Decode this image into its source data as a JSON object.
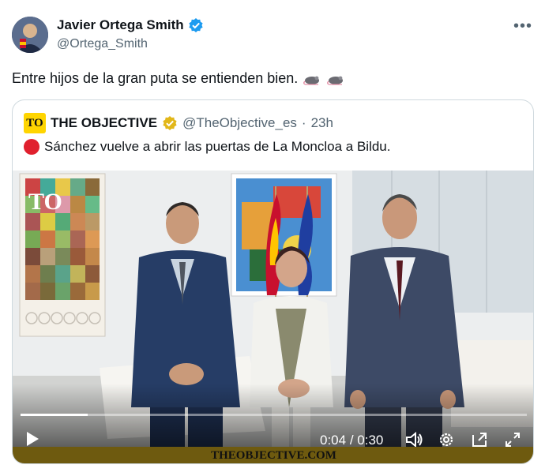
{
  "author": {
    "name": "Javier Ortega Smith",
    "handle": "@Ortega_Smith"
  },
  "tweet": {
    "text": "Entre hijos de la gran puta se entienden bien.",
    "emoji": [
      "rat-icon",
      "rat-icon"
    ]
  },
  "quote": {
    "logo_text": "TO",
    "name": "THE OBJECTIVE",
    "handle": "@TheObjective_es",
    "separator": "·",
    "time": "23h",
    "text": "Sánchez vuelve a abrir las puertas de La Moncloa a Bildu."
  },
  "video": {
    "overlay_logo": "TO",
    "current_time": "0:04",
    "duration": "0:30",
    "time_separator": " / ",
    "progress": 0.133,
    "watermark": "THEOBJECTIVE.COM"
  },
  "colors": {
    "verified": "#1d9bf0",
    "logo_yellow": "#ffd500",
    "red_dot": "#e0202e"
  }
}
